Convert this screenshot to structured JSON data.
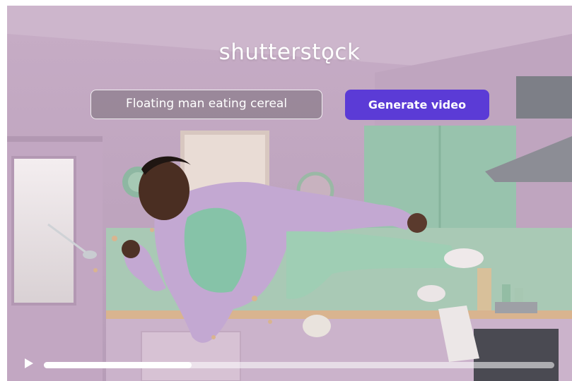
{
  "brand": {
    "logo_text": "shutterstǫck"
  },
  "prompt": {
    "value": "Floating man eating cereal"
  },
  "generate_button": {
    "label": "Generate video",
    "color": "#5b3bd6"
  },
  "player": {
    "progress": 0.29,
    "play_icon": "play-icon"
  }
}
